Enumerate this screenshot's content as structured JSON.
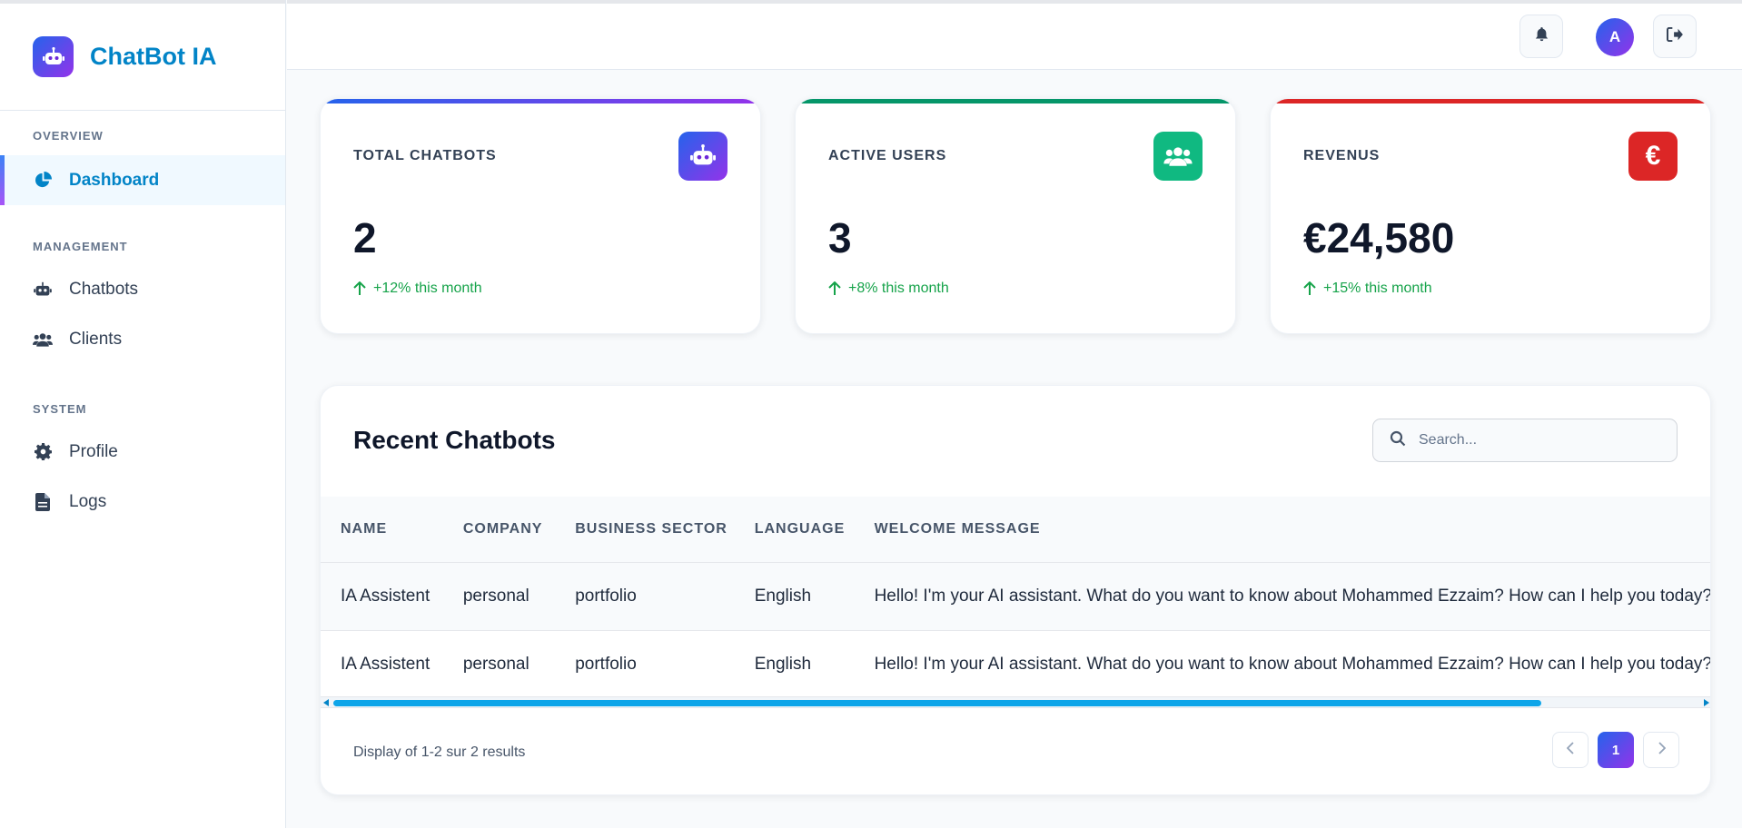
{
  "app": {
    "brand_name": "ChatBot IA",
    "accent_color": "#0284c7",
    "gradient_start": "#2563eb",
    "gradient_end": "#9333ea"
  },
  "sidebar": {
    "sections": [
      {
        "title": "OVERVIEW",
        "items": [
          {
            "label": "Dashboard",
            "icon": "pie-chart-icon",
            "active": true
          }
        ]
      },
      {
        "title": "MANAGEMENT",
        "items": [
          {
            "label": "Chatbots",
            "icon": "robot-icon"
          },
          {
            "label": "Clients",
            "icon": "users-icon"
          }
        ]
      },
      {
        "title": "SYSTEM",
        "items": [
          {
            "label": "Profile",
            "icon": "gear-icon"
          },
          {
            "label": "Logs",
            "icon": "file-icon"
          }
        ]
      }
    ]
  },
  "topbar": {
    "avatar_initial": "A",
    "icons": [
      "bell-icon",
      "logout-icon"
    ]
  },
  "stats": [
    {
      "label": "TOTAL CHATBOTS",
      "value": "2",
      "trend": "+12% this month",
      "icon": "robot-icon",
      "color": "#4f46e5"
    },
    {
      "label": "ACTIVE USERS",
      "value": "3",
      "trend": "+8% this month",
      "icon": "users-icon",
      "color": "#059669"
    },
    {
      "label": "REVENUS",
      "value": "€24,580",
      "trend": "+15% this month",
      "icon": "euro-icon",
      "color": "#dc2626"
    }
  ],
  "recent": {
    "title": "Recent Chatbots",
    "search_placeholder": "Search...",
    "columns": [
      "NAME",
      "COMPANY",
      "BUSINESS SECTOR",
      "LANGUAGE",
      "WELCOME MESSAGE"
    ],
    "rows": [
      {
        "name": "IA Assistent",
        "company": "personal",
        "sector": "portfolio",
        "language": "English",
        "welcome": "Hello! I'm your AI assistant. What do you want to know about Mohammed Ezzaim? How can I help you today?"
      },
      {
        "name": "IA Assistent",
        "company": "personal",
        "sector": "portfolio",
        "language": "English",
        "welcome": "Hello! I'm your AI assistant. What do you want to know about Mohammed Ezzaim? How can I help you today?"
      }
    ],
    "pagination_text": "Display of 1-2 sur 2 results",
    "current_page": "1"
  }
}
